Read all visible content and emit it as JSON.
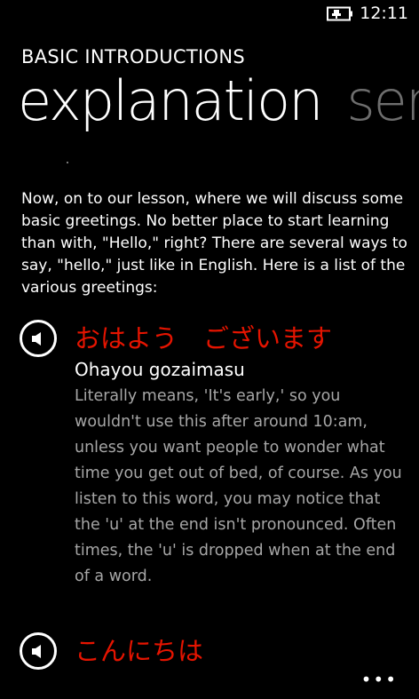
{
  "status_bar": {
    "time": "12:11",
    "battery_icon": "battery-charging-icon"
  },
  "header": {
    "app_title": "BASIC INTRODUCTIONS",
    "pivot_items": [
      "explanation",
      "ser"
    ]
  },
  "content": {
    "intro": "Now, on to our lesson, where we will discuss some basic greetings. No better place to start learning than with, \"Hello,\" right? There are several ways to say, \"hello,\" just like in English. Here is a list of the various greetings:",
    "entries": [
      {
        "japanese": "おはよう　ございます",
        "romaji": "Ohayou gozaimasu",
        "description": "Literally means, 'It's early,' so you wouldn't use this after around 10:am, unless you want people to wonder what time you get out of bed, of course. As you listen to this word, you may notice that the 'u' at the end isn't pronounced. Often times, the 'u' is dropped when at the end of a word."
      },
      {
        "japanese": "こんにちは"
      }
    ]
  },
  "app_bar": {
    "more_label": "•••"
  },
  "colors": {
    "background": "#000000",
    "accent_red": "#e51400",
    "secondary_text": "#a6a6a6",
    "inactive_pivot": "#6e6e6e"
  }
}
